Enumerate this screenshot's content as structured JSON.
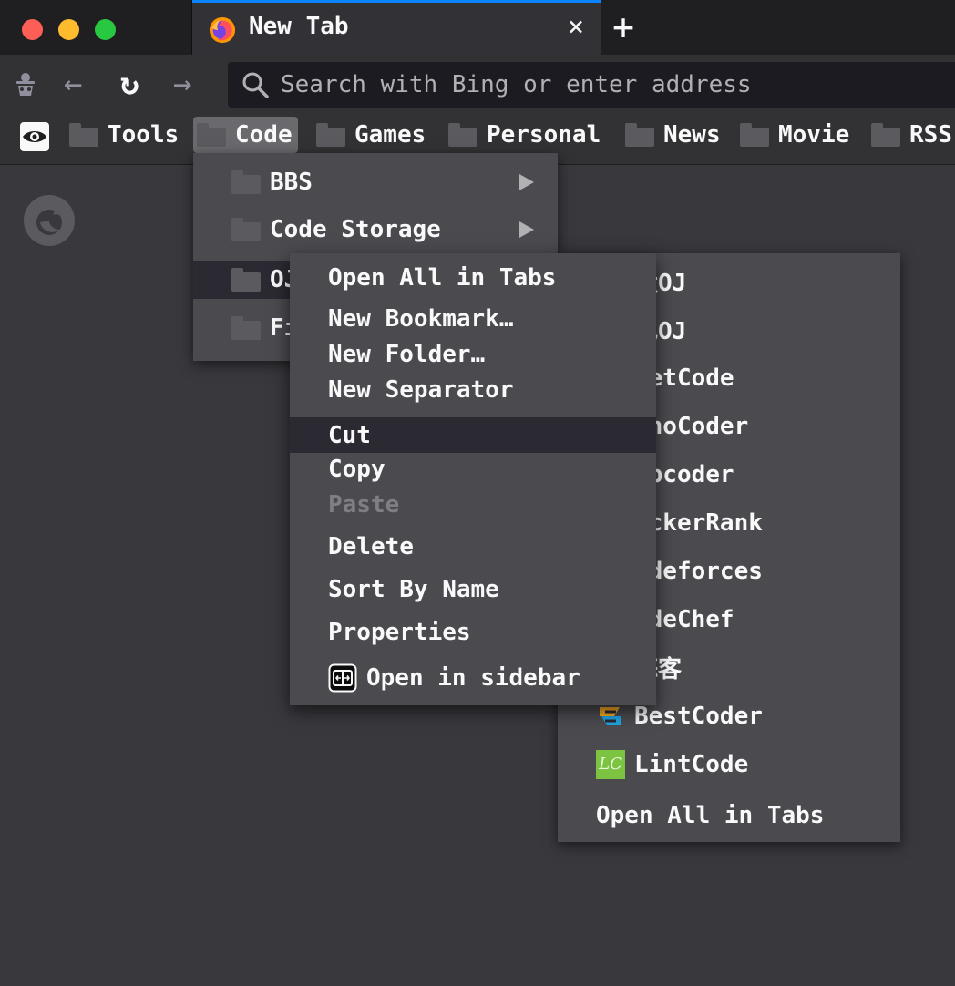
{
  "tab": {
    "title": "New Tab",
    "close_glyph": "×",
    "favicon": "firefox-icon"
  },
  "tabbar": {
    "new_tab_glyph": "+"
  },
  "nav": {
    "back_glyph": "←",
    "reload_glyph": "↻",
    "forward_glyph": "→",
    "url_placeholder": "Search with Bing or enter address",
    "url_value": ""
  },
  "bookmarks_toolbar": {
    "items": [
      {
        "label": "Tools"
      },
      {
        "label": "Code"
      },
      {
        "label": "Games"
      },
      {
        "label": "Personal"
      },
      {
        "label": "News"
      },
      {
        "label": "Movie"
      },
      {
        "label": "RSS"
      }
    ]
  },
  "code_menu": {
    "items": [
      {
        "label": "BBS",
        "has_submenu": true
      },
      {
        "label": "Code Storage",
        "has_submenu": true
      },
      {
        "label": "OJ",
        "has_submenu": true
      },
      {
        "label": "Fi",
        "has_submenu": false
      }
    ]
  },
  "oj_menu": {
    "items": [
      {
        "label": "大OJ"
      },
      {
        "label": "电OJ"
      },
      {
        "label": "eetCode"
      },
      {
        "label": "ihoCoder"
      },
      {
        "label": "opcoder"
      },
      {
        "label": "ackerRank"
      },
      {
        "label": "odeforces"
      },
      {
        "label": "odeChef"
      },
      {
        "label": "蒜客"
      },
      {
        "label": "BestCoder",
        "icon": "bestcoder-icon"
      },
      {
        "label": "LintCode",
        "icon": "lintcode-icon",
        "icon_text": "LC"
      },
      {
        "label": "Open All in Tabs"
      }
    ]
  },
  "context_menu": {
    "items": [
      {
        "label": "Open All in Tabs"
      },
      {
        "label": "New Bookmark…"
      },
      {
        "label": "New Folder…"
      },
      {
        "label": "New Separator"
      },
      {
        "label": "Cut",
        "highlighted": true
      },
      {
        "label": "Copy"
      },
      {
        "label": "Paste",
        "disabled": true
      },
      {
        "label": "Delete"
      },
      {
        "label": "Sort By Name"
      },
      {
        "label": "Properties"
      },
      {
        "label": "Open in sidebar",
        "icon": "sidebar-icon"
      }
    ]
  },
  "colors": {
    "accent": "#0a84ff",
    "menu_bg": "#4a4a4f",
    "menu_highlight": "#2b2a33",
    "page_bg": "#38383d"
  }
}
